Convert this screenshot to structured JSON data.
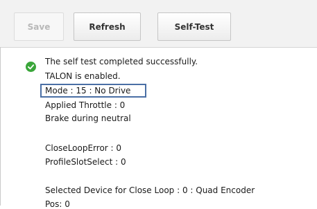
{
  "toolbar": {
    "save_label": "Save",
    "refresh_label": "Refresh",
    "selftest_label": "Self-Test"
  },
  "status": {
    "icon": "success-check-icon",
    "success_color": "#3aa63a",
    "lines": [
      "The self test completed successfully.",
      "TALON is enabled.",
      "Mode : 15 : No Drive",
      "Applied Throttle : 0",
      "Brake during neutral",
      "CloseLoopError : 0",
      "ProfileSlotSelect : 0",
      "Selected Device for Close Loop : 0 : Quad Encoder",
      "Pos: 0"
    ]
  }
}
